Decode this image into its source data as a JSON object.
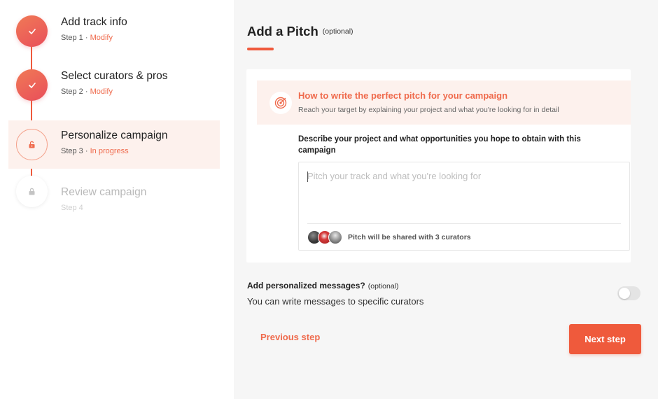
{
  "sidebar": {
    "steps": [
      {
        "title": "Add track info",
        "step_label": "Step 1",
        "separator": " · ",
        "status": "Modify",
        "state": "done",
        "icon": "check-icon"
      },
      {
        "title": "Select curators & pros",
        "step_label": "Step 2",
        "separator": " · ",
        "status": "Modify",
        "state": "done",
        "icon": "check-icon"
      },
      {
        "title": "Personalize campaign",
        "step_label": "Step 3",
        "separator": " · ",
        "status": "In progress",
        "state": "current",
        "icon": "unlock-icon"
      },
      {
        "title": "Review campaign",
        "step_label": "Step 4",
        "separator": "",
        "status": "",
        "state": "locked",
        "icon": "lock-icon"
      }
    ]
  },
  "main": {
    "title": "Add a Pitch",
    "title_optional": "(optional)",
    "tip": {
      "icon": "target-icon",
      "title": "How to write the perfect pitch for your campaign",
      "subtitle": "Reach your target by explaining your project and what you're looking for in detail"
    },
    "pitch": {
      "label": "Describe your project and what opportunities you hope to obtain with this campaign",
      "placeholder": "Pitch your track and what you're looking for",
      "value": "",
      "share_text": "Pitch will be shared with 3 curators",
      "avatar_count": 3
    },
    "messages": {
      "title": "Add personalized messages?",
      "optional": "(optional)",
      "subtitle": "You can write messages to specific curators",
      "toggle_on": false
    },
    "actions": {
      "previous": "Previous step",
      "next": "Next step"
    }
  },
  "colors": {
    "accent": "#ef5a3c",
    "accent_light": "#fdf1ed",
    "page_bg": "#f6f6f6",
    "muted_text": "#b9b9b9"
  }
}
